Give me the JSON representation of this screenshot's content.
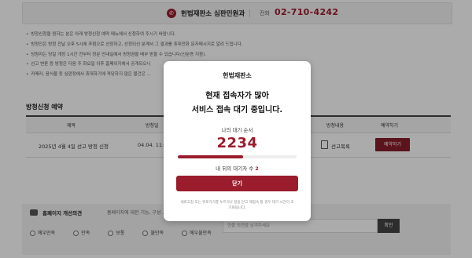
{
  "contact": {
    "dept": "헌법재판소 심판민원과",
    "tel_label": "전화",
    "tel_number": "02-710-4242"
  },
  "notices": [
    "방청신청을 원하는 분은 아래 방청신청 예약 메뉴에서 신청하여 주시기 바랍니다.",
    "방청인은 방청 전날 오후 5시에 추첨으로 선정하고, 선정되신 분께서 그 결과를 휴대전화 문자메시지로 알려 드립니다.",
    "당첨자는 당일 개정 1시간 전부터 정문 안내실에서 방청권을 배부 받을 수 있습니다(신분증 지참).",
    "선고 변론 등 방청은 다음 주 화요일 이후 홈페이지에서 공개되오니",
    "카메라, 음식물 등 심판정에서 휴대하기에 적당하지 않은 물건은 ..."
  ],
  "reservation": {
    "title": "방청신청 예약",
    "headers": [
      "제목",
      "방청일",
      "방청내용",
      "예약하기"
    ],
    "row": {
      "title": "2025년 4월 4일 선고 방청 신청",
      "date": "04.04. 11:00",
      "content": "선고목록",
      "apply": "예약하기"
    }
  },
  "feedback": {
    "title": "홈페이지 개선의견",
    "desc": "홈페이지에 대한 기능, 구성 ...                                 정보에 대해 만족하십니까?",
    "options": [
      "매우만족",
      "만족",
      "보통",
      "불만족",
      "매우불만족"
    ],
    "placeholder": "한줄 의견을 남겨주세요",
    "button": "확인"
  },
  "modal": {
    "org": "헌법재판소",
    "headline_1": "현재 접속자가 많아",
    "headline_2": "서비스 접속 대기 중입니다.",
    "queue_label": "나의 대기 순서",
    "queue_number": "2234",
    "progress_fraction": 0.55,
    "behind_label": "내 뒤의 대기자 수",
    "behind_count": "2",
    "close_label": "닫기",
    "note": "새로고침 또는 뒤로가기를 누르거나 창을 닫고 재접속 할 경우 대기 시간이 초기화됩니다."
  },
  "colors": {
    "accent": "#9b1c2c",
    "overlay": "rgba(0,0,0,0.33)"
  }
}
